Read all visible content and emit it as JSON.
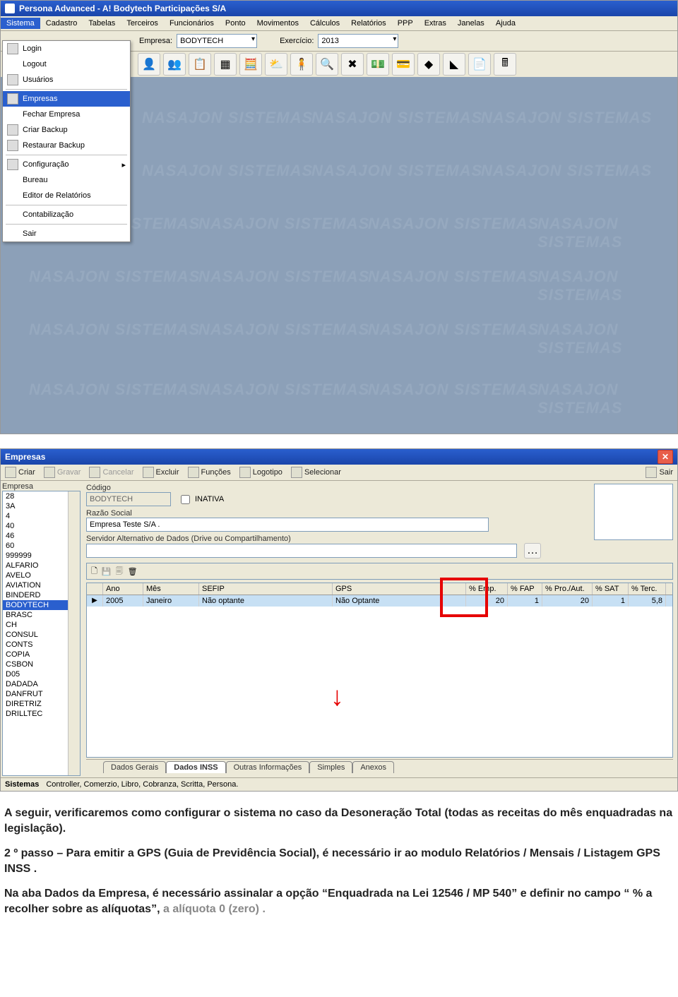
{
  "app": {
    "title": "Persona Advanced  -  A! Bodytech Participações S/A",
    "menus": [
      "Sistema",
      "Cadastro",
      "Tabelas",
      "Terceiros",
      "Funcionários",
      "Ponto",
      "Movimentos",
      "Cálculos",
      "Relatórios",
      "PPP",
      "Extras",
      "Janelas",
      "Ajuda"
    ],
    "empresa_label": "Empresa:",
    "empresa_value": "BODYTECH",
    "exercicio_label": "Exercício:",
    "exercicio_value": "2013",
    "watermark": "NASAJON  SISTEMAS",
    "dropdown": {
      "items": [
        {
          "label": "Login",
          "icon": true
        },
        {
          "label": "Logout"
        },
        {
          "label": "Usuários",
          "icon": true
        },
        {
          "sep": true
        },
        {
          "label": "Empresas",
          "icon": true,
          "highlight": true
        },
        {
          "label": "Fechar Empresa"
        },
        {
          "label": "Criar Backup",
          "icon": true
        },
        {
          "label": "Restaurar Backup",
          "icon": true
        },
        {
          "sep": true
        },
        {
          "label": "Configuração",
          "icon": true,
          "submenu": true
        },
        {
          "label": "Bureau"
        },
        {
          "label": "Editor de Relatórios"
        },
        {
          "sep": true
        },
        {
          "label": "Contabilização"
        },
        {
          "sep": true
        },
        {
          "label": "Sair"
        }
      ]
    }
  },
  "dialog": {
    "title": "Empresas",
    "toolbar": {
      "criar": "Criar",
      "gravar": "Gravar",
      "cancelar": "Cancelar",
      "excluir": "Excluir",
      "funcoes": "Funções",
      "logotipo": "Logotipo",
      "selecionar": "Selecionar",
      "sair": "Sair"
    },
    "list_label": "Empresa",
    "list_items": [
      "28",
      "3A",
      "4",
      "40",
      "46",
      "60",
      "999999",
      "ALFARIO",
      "AVELO",
      "AVIATION",
      "BINDERD",
      "BODYTECH",
      "BRASC",
      "CH",
      "CONSUL",
      "CONTS",
      "COPIA",
      "CSBON",
      "D05",
      "DADADA",
      "DANFRUT",
      "DIRETRIZ",
      "DRILLTEC"
    ],
    "list_selected": "BODYTECH",
    "form": {
      "codigo_label": "Código",
      "codigo_value": "BODYTECH",
      "inativa_label": "INATIVA",
      "razao_label": "Razão Social",
      "razao_value": "Empresa Teste S/A .",
      "servidor_label": "Servidor Alternativo de Dados (Drive ou Compartilhamento)"
    },
    "grid": {
      "headers": [
        "Ano",
        "Mês",
        "SEFIP",
        "GPS",
        "% Emp.",
        "% FAP",
        "% Pro./Aut.",
        "% SAT",
        "% Terc."
      ],
      "row": {
        "ano": "2005",
        "mes": "Janeiro",
        "sefip": "Não optante",
        "gps": "Não Optante",
        "emp": "20",
        "fap": "1",
        "proaut": "20",
        "sat": "1",
        "terc": "5,8"
      }
    },
    "tabs": [
      "Dados Gerais",
      "Dados INSS",
      "Outras Informações",
      "Simples",
      "Anexos"
    ],
    "status": {
      "a": "Sistemas",
      "b": "Controller, Comerzio, Libro, Cobranza, Scritta, Persona."
    }
  },
  "doc": {
    "p1": "A seguir, verificaremos como configurar o sistema no caso da Desoneração Total (todas as receitas do mês enquadradas na legislação).",
    "p2a": "2 º passo – Para emitir a GPS (Guia de Previdência Social), é necessário ir ao modulo ",
    "p2b": "Relatórios / Mensais / Listagem GPS INSS .",
    "p3a": "Na aba Dados da Empresa, é necessário assinalar a opção ",
    "p3b": "“Enquadrada na Lei 12546 / MP 540”",
    "p3c": " e definir no campo ",
    "p3d": "“ % a recolher sobre as alíquotas”, ",
    "p3e": "a alíquota 0 (zero) ."
  }
}
